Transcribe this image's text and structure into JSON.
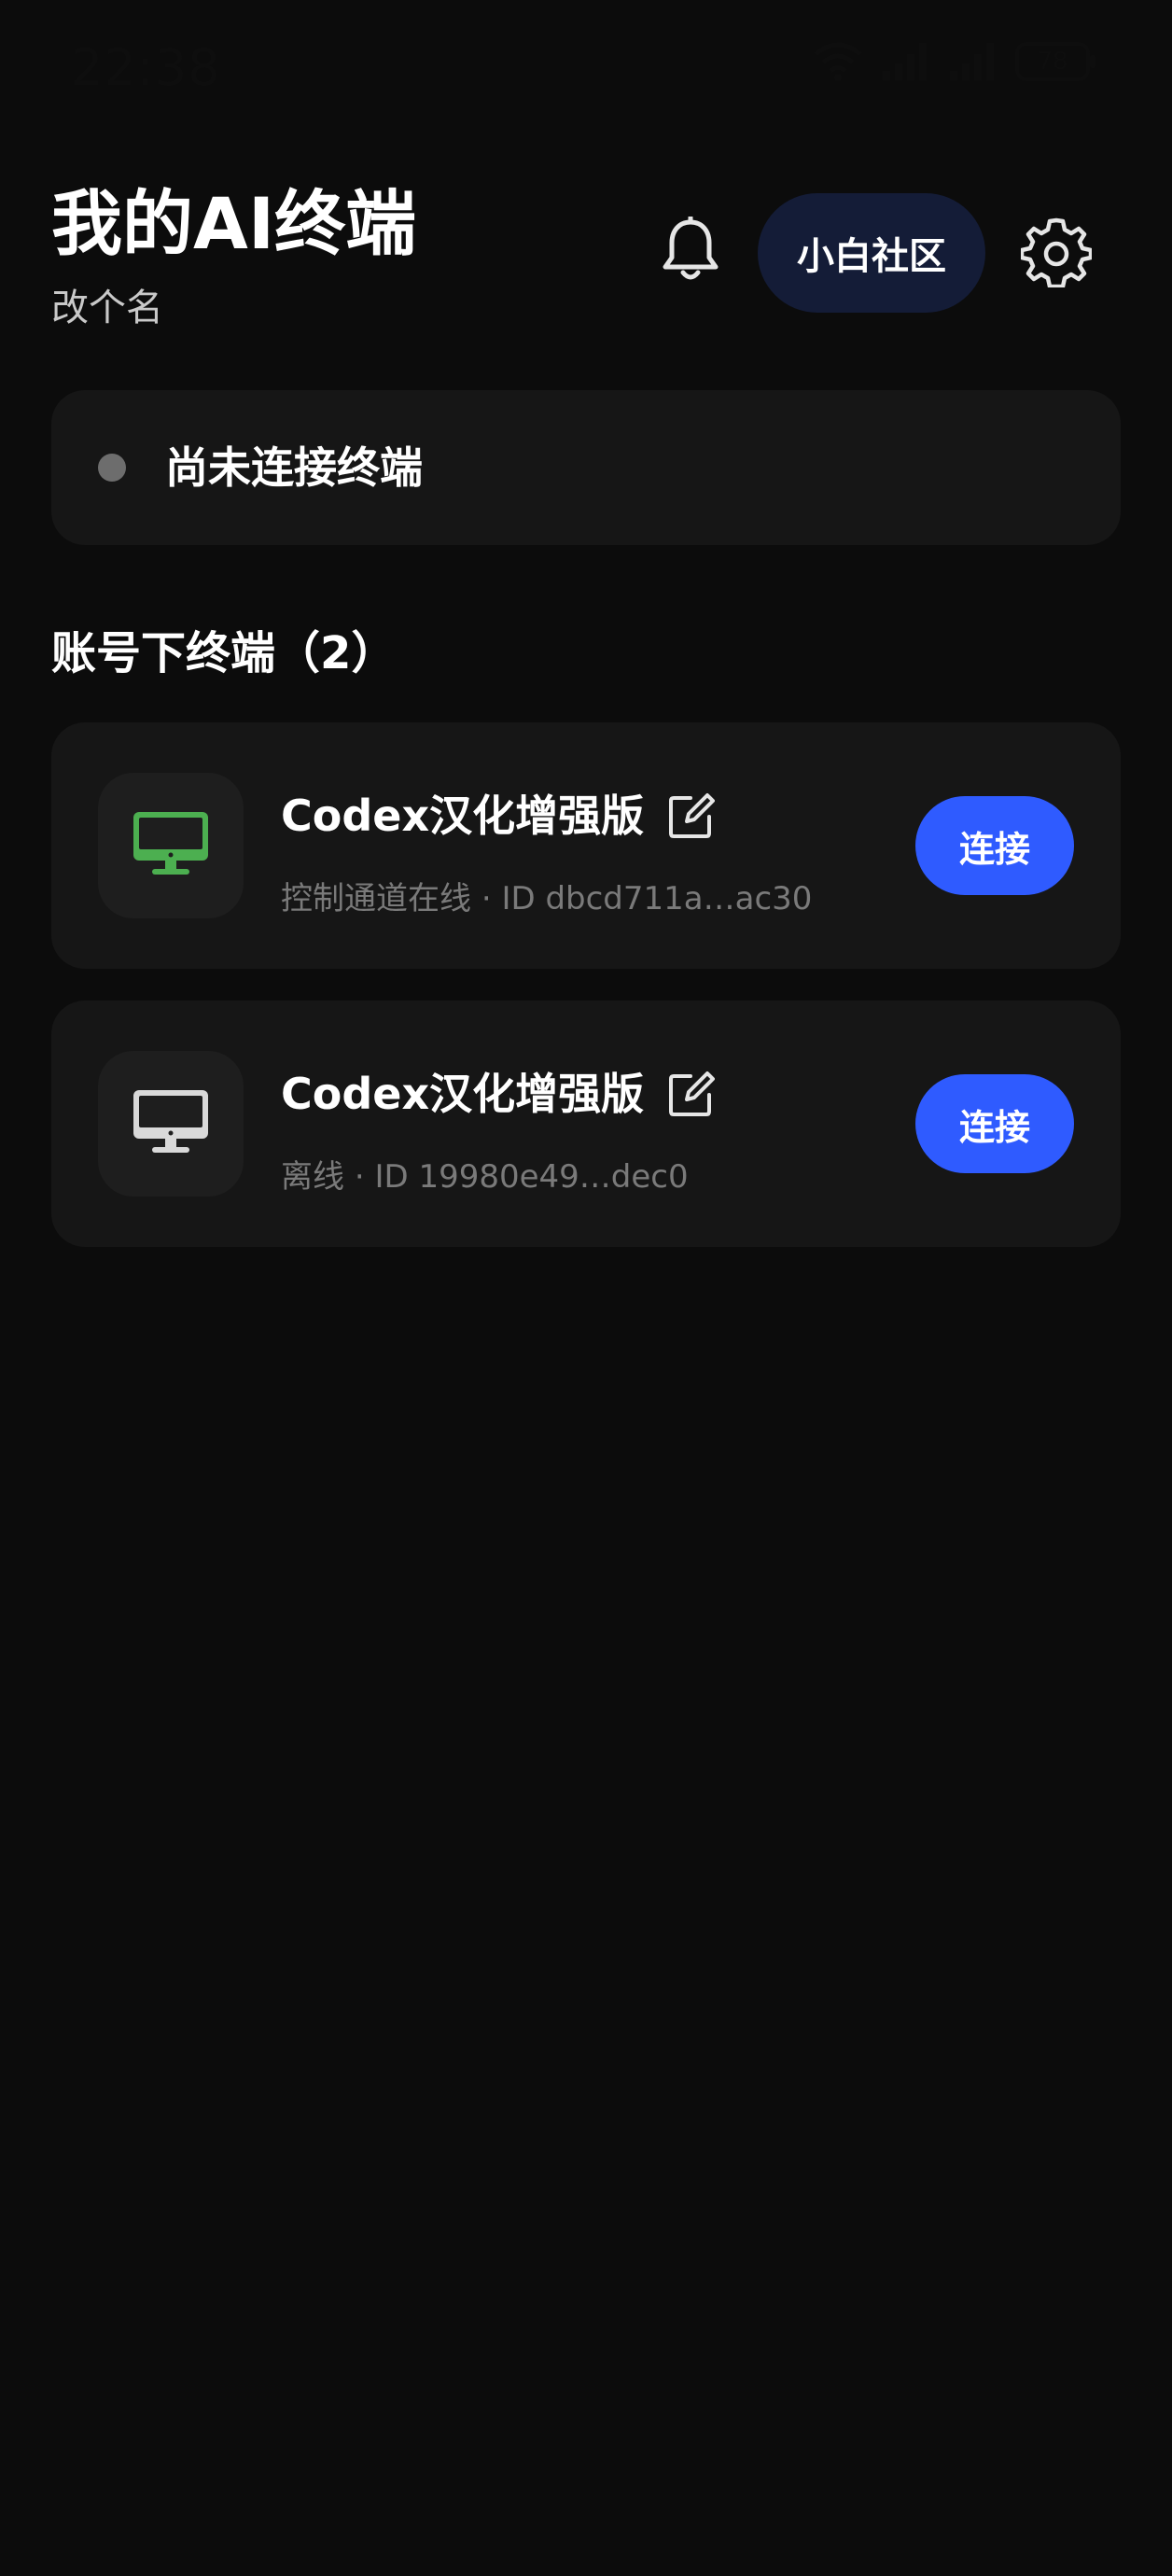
{
  "status_bar": {
    "time": "22:38",
    "battery": "78"
  },
  "header": {
    "title": "我的AI终端",
    "subtitle": "改个名",
    "community_label": "小白社区"
  },
  "connection": {
    "status_text": "尚未连接终端"
  },
  "section": {
    "title": "账号下终端（2）"
  },
  "terminals": [
    {
      "name": "Codex汉化增强版",
      "status": "控制通道在线",
      "id_label": "ID dbcd711a…ac30",
      "connect_label": "连接",
      "icon_color": "#4caf50"
    },
    {
      "name": "Codex汉化增强版",
      "status": "离线",
      "id_label": "ID 19980e49…dec0",
      "connect_label": "连接",
      "icon_color": "#d9d9d9"
    }
  ],
  "colors": {
    "background": "#0c0c0c",
    "card": "#161616",
    "accent": "#2f5bff",
    "community_bg": "#141c37",
    "online": "#4caf50"
  }
}
